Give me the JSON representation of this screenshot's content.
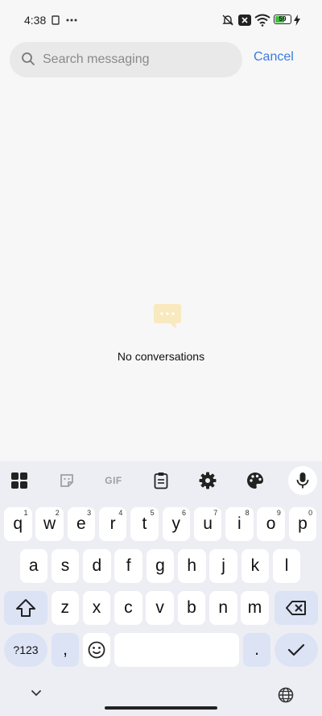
{
  "status_bar": {
    "time": "4:38",
    "battery": "59",
    "battery_level": 0.59
  },
  "search": {
    "placeholder": "Search messaging",
    "value": "",
    "cancel_label": "Cancel"
  },
  "empty_state": {
    "text": "No conversations"
  },
  "keyboard": {
    "toolbar": {
      "gif_label": "GIF"
    },
    "row1": [
      {
        "k": "q",
        "hint": "1"
      },
      {
        "k": "w",
        "hint": "2"
      },
      {
        "k": "e",
        "hint": "3"
      },
      {
        "k": "r",
        "hint": "4"
      },
      {
        "k": "t",
        "hint": "5"
      },
      {
        "k": "y",
        "hint": "6"
      },
      {
        "k": "u",
        "hint": "7"
      },
      {
        "k": "i",
        "hint": "8"
      },
      {
        "k": "o",
        "hint": "9"
      },
      {
        "k": "p",
        "hint": "0"
      }
    ],
    "row2": [
      "a",
      "s",
      "d",
      "f",
      "g",
      "h",
      "j",
      "k",
      "l"
    ],
    "row3": [
      "z",
      "x",
      "c",
      "v",
      "b",
      "n",
      "m"
    ],
    "symbols_label": "?123",
    "comma_label": ",",
    "period_label": "."
  },
  "colors": {
    "accent": "#3a7ae0",
    "keyboard_bg": "#edeef4",
    "special_key": "#dce3f5",
    "empty_icon": "#f5e3b3"
  }
}
